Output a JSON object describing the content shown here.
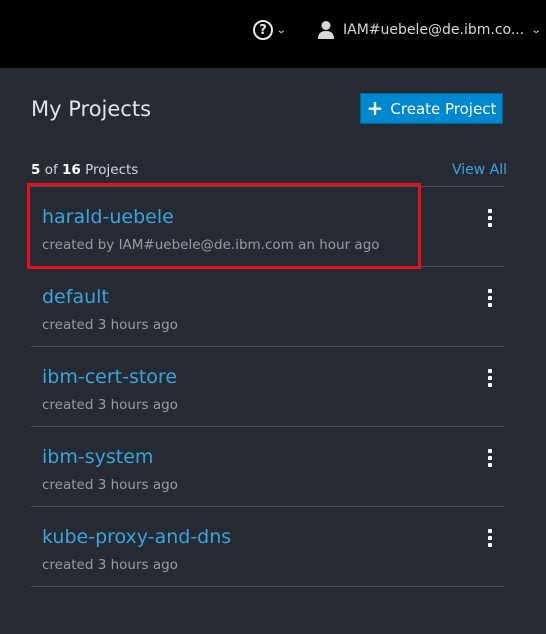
{
  "header": {
    "help_icon": "question-circle-icon",
    "user_icon": "user-icon",
    "user_name": "IAM#uebele@de.ibm.co...",
    "colors": {
      "background": "#000000",
      "text": "#d8d8d8"
    }
  },
  "main": {
    "title": "My Projects",
    "create_button": {
      "icon": "plus-icon",
      "label": "Create Project",
      "color": "#0088ce"
    },
    "count": {
      "shown": "5",
      "of": "of",
      "total": "16",
      "suffix": "Projects"
    },
    "view_all": "View All",
    "projects": [
      {
        "name": "harald-uebele",
        "meta": "created by IAM#uebele@de.ibm.com an hour ago",
        "highlighted": true
      },
      {
        "name": "default",
        "meta": "created 3 hours ago"
      },
      {
        "name": "ibm-cert-store",
        "meta": "created 3 hours ago"
      },
      {
        "name": "ibm-system",
        "meta": "created 3 hours ago"
      },
      {
        "name": "kube-proxy-and-dns",
        "meta": "created 3 hours ago"
      }
    ],
    "colors": {
      "background": "#262b33",
      "link": "#39a5dc",
      "highlight": "#e8101c"
    }
  }
}
